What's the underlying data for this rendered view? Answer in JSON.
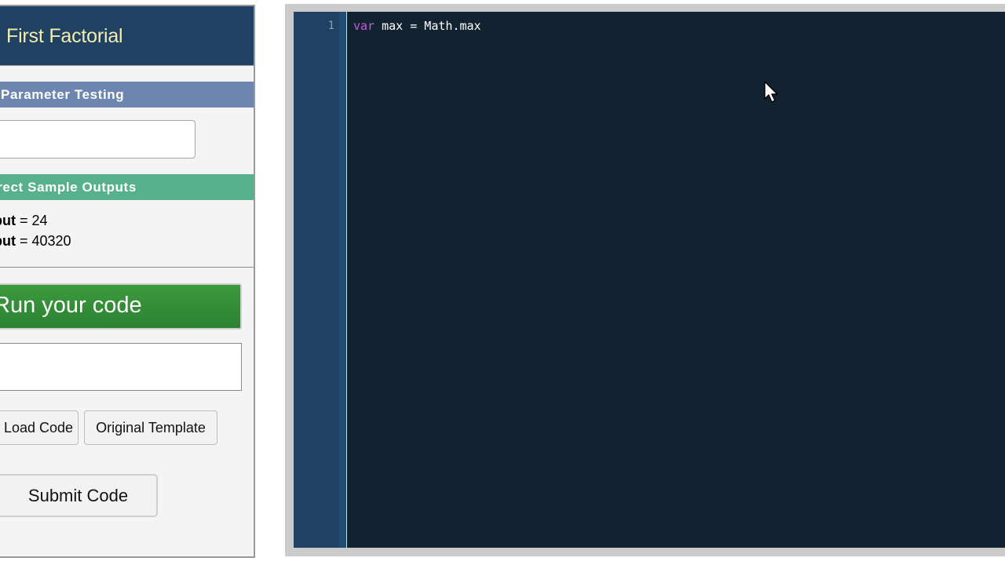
{
  "challenge": {
    "title": "First Factorial"
  },
  "sections": {
    "parameter_testing": "Parameter Testing",
    "correct_sample_outputs": "rrect Sample Outputs"
  },
  "parameter_input": {
    "value": ""
  },
  "samples": [
    {
      "label": "tput",
      "separator": " = ",
      "value": "24"
    },
    {
      "label": "tput",
      "separator": " = ",
      "value": "40320"
    }
  ],
  "buttons": {
    "run": "Run your code",
    "load": "Load Code",
    "template": "Original Template",
    "submit": "Submit Code"
  },
  "output_box": {
    "value": ""
  },
  "editor": {
    "line_number": "1",
    "code_keyword": "var",
    "code_rest": " max = Math.max",
    "colors": {
      "background": "#132230",
      "gutter": "#1f4263",
      "keyword": "#c25ee0"
    }
  },
  "icons": {
    "cursor": "mouse-pointer-icon"
  }
}
